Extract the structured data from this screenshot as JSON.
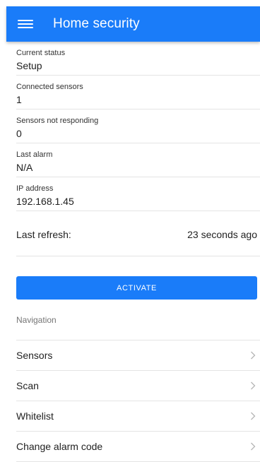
{
  "app_bar": {
    "title": "Home security",
    "menu_icon": "hamburger-menu-icon",
    "color": "#1a7cf9"
  },
  "status": {
    "items": [
      {
        "label": "Current status",
        "value": "Setup"
      },
      {
        "label": "Connected sensors",
        "value": "1"
      },
      {
        "label": "Sensors not responding",
        "value": "0"
      },
      {
        "label": "Last alarm",
        "value": "N/A"
      },
      {
        "label": "IP address",
        "value": "192.168.1.45"
      }
    ],
    "last_refresh_label": "Last refresh:",
    "last_refresh_value": "23 seconds ago"
  },
  "actions": {
    "activate_label": "ACTIVATE"
  },
  "navigation": {
    "header": "Navigation",
    "items": [
      {
        "label": "Sensors",
        "icon": "chevron-right-icon"
      },
      {
        "label": "Scan",
        "icon": "chevron-right-icon"
      },
      {
        "label": "Whitelist",
        "icon": "chevron-right-icon"
      },
      {
        "label": "Change alarm code",
        "icon": "chevron-right-icon"
      }
    ]
  }
}
